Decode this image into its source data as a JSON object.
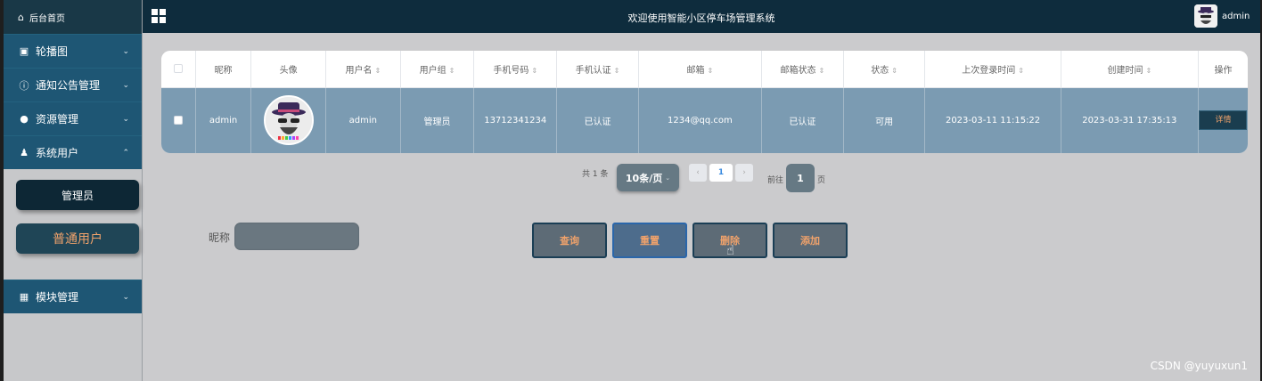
{
  "sidebar": {
    "home": {
      "label": "后台首页",
      "icon": "home-icon"
    },
    "items": [
      {
        "label": "轮播图",
        "icon": "image-icon",
        "chevron": "⌄"
      },
      {
        "label": "通知公告管理",
        "icon": "info-icon",
        "chevron": "⌄"
      },
      {
        "label": "资源管理",
        "icon": "location-icon",
        "chevron": "⌄"
      },
      {
        "label": "系统用户",
        "icon": "user-icon",
        "chevron": "⌃"
      }
    ],
    "subitems": [
      "管理员",
      "普通用户"
    ],
    "module": {
      "label": "模块管理",
      "icon": "grid-icon",
      "chevron": "⌄"
    }
  },
  "header": {
    "title": "欢迎使用智能小区停车场管理系统",
    "username": "admin"
  },
  "table": {
    "columns": [
      "昵称",
      "头像",
      "用户名",
      "用户组",
      "手机号码",
      "手机认证",
      "邮箱",
      "邮箱状态",
      "状态",
      "上次登录时间",
      "创建时间",
      "操作"
    ],
    "rows": [
      {
        "nickname": "admin",
        "username": "admin",
        "group": "管理员",
        "phone": "13712341234",
        "phone_verified": "已认证",
        "email": "1234@qq.com",
        "email_status": "已认证",
        "status": "可用",
        "last_login": "2023-03-11 11:15:22",
        "created": "2023-03-31 17:35:13",
        "action": "详情"
      }
    ]
  },
  "pagination": {
    "total": "共 1 条",
    "page_size": "10条/页",
    "current": "1",
    "goto_label": "前往",
    "goto_value": "1",
    "unit": "页"
  },
  "search": {
    "label": "昵称",
    "value": ""
  },
  "actions": {
    "query": "查询",
    "reset": "重置",
    "delete": "删除",
    "add": "添加"
  },
  "watermark": "CSDN @yuyuxun1"
}
